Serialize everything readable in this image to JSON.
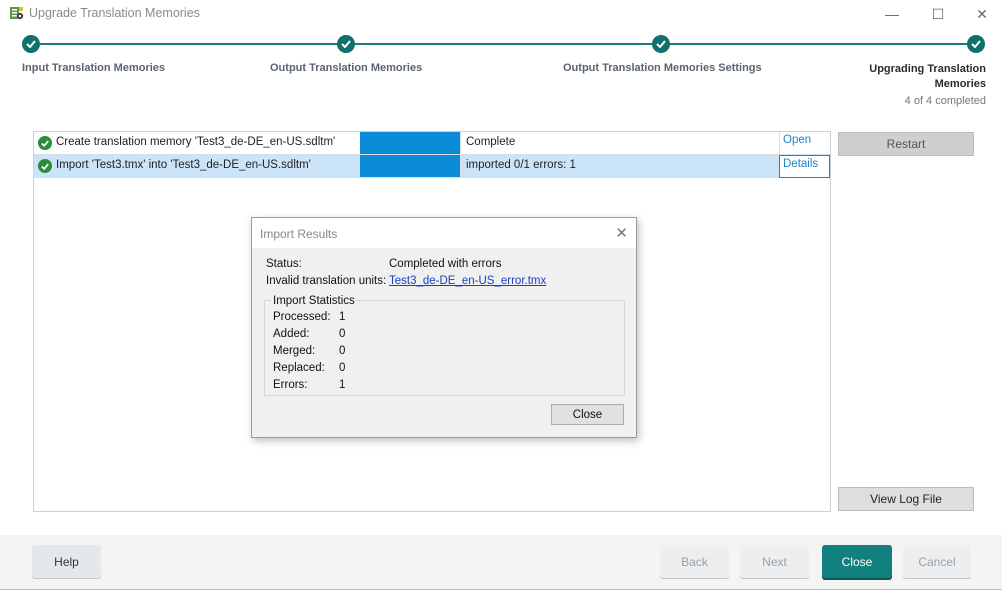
{
  "window": {
    "title": "Upgrade Translation Memories",
    "controls": {
      "minimize": "—",
      "maximize": "☐",
      "close": "✕"
    }
  },
  "stepper": {
    "steps": [
      {
        "label": "Input Translation Memories",
        "state": "done"
      },
      {
        "label": "Output Translation Memories",
        "state": "done"
      },
      {
        "label": "Output Translation Memories Settings",
        "state": "done"
      },
      {
        "label_line1": "Upgrading Translation",
        "label_line2": "Memories",
        "state": "current"
      }
    ],
    "progress_text": "4 of 4 completed"
  },
  "tasks": [
    {
      "name": "Create translation memory 'Test3_de-DE_en-US.sdltm'",
      "progress": 1.0,
      "status": "Complete",
      "action": "Open",
      "selected": false
    },
    {
      "name": "Import 'Test3.tmx' into 'Test3_de-DE_en-US.sdltm'",
      "progress": 1.0,
      "status": "imported 0/1 errors: 1",
      "action": "Details",
      "selected": true
    }
  ],
  "side_buttons": {
    "restart": "Restart",
    "view_log": "View Log File"
  },
  "footer": {
    "help": "Help",
    "back": "Back",
    "next": "Next",
    "close": "Close",
    "cancel": "Cancel"
  },
  "dialog": {
    "title": "Import Results",
    "close_glyph": "✕",
    "status_label": "Status:",
    "status_value": "Completed with errors",
    "invalid_label": "Invalid translation units:",
    "invalid_link": "Test3_de-DE_en-US_error.tmx",
    "stats_title": "Import Statistics",
    "stats": [
      {
        "label": "Processed:",
        "value": "1"
      },
      {
        "label": "Added:",
        "value": "0"
      },
      {
        "label": "Merged:",
        "value": "0"
      },
      {
        "label": "Replaced:",
        "value": "0"
      },
      {
        "label": "Errors:",
        "value": "1"
      }
    ],
    "close_button": "Close"
  },
  "colors": {
    "accent": "#11706e",
    "progress": "#0a8cd8",
    "selection": "#cce4f7",
    "link": "#1b84c2"
  }
}
